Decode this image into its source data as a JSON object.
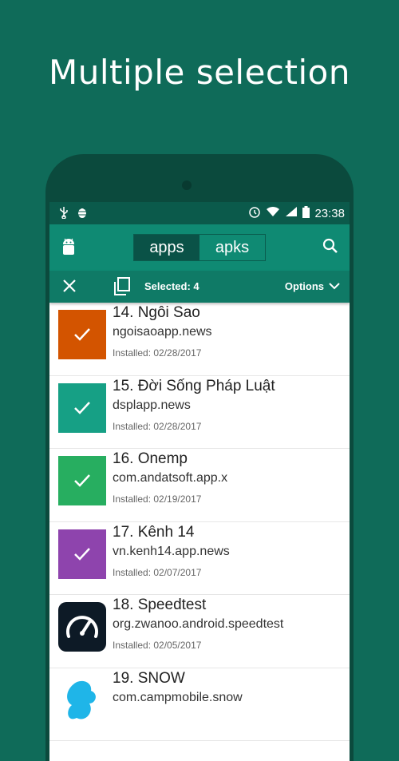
{
  "promo": {
    "headline": "Multiple selection"
  },
  "status_bar": {
    "time": "23:38"
  },
  "toolbar": {
    "tabs": [
      "apps",
      "apks"
    ],
    "active_tab": "apps"
  },
  "action_bar": {
    "selected_label": "Selected: 4",
    "options_label": "Options"
  },
  "colors": {
    "background": "#0f6b59",
    "toolbar": "#0f8a73"
  },
  "items": [
    {
      "title": "14. Ngôi Sao",
      "package": "ngoisaoapp.news",
      "installed": "Installed: 02/28/2017",
      "selected": true,
      "color": "#d35400"
    },
    {
      "title": "15. Đời Sống Pháp Luật",
      "package": "dsplapp.news",
      "installed": "Installed: 02/28/2017",
      "selected": true,
      "color": "#16a085"
    },
    {
      "title": "16. Onemp",
      "package": "com.andatsoft.app.x",
      "installed": "Installed: 02/19/2017",
      "selected": true,
      "color": "#27ae60"
    },
    {
      "title": "17. Kênh 14",
      "package": "vn.kenh14.app.news",
      "installed": "Installed: 02/07/2017",
      "selected": true,
      "color": "#8e44ad"
    },
    {
      "title": "18. Speedtest",
      "package": "org.zwanoo.android.speedtest",
      "installed": "Installed: 02/05/2017",
      "selected": false,
      "icon": "speedtest-icon"
    },
    {
      "title": "19. SNOW",
      "package": "com.campmobile.snow",
      "installed": "",
      "selected": false,
      "icon": "snow-icon"
    }
  ]
}
